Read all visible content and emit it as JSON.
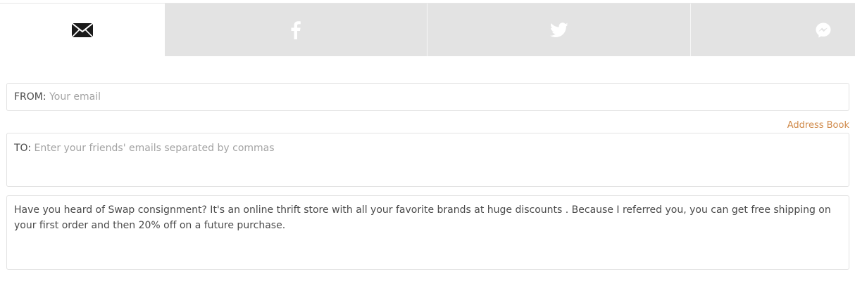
{
  "tabs": [
    {
      "name": "email",
      "icon": "envelope-icon",
      "active": true
    },
    {
      "name": "facebook",
      "icon": "facebook-icon",
      "active": false
    },
    {
      "name": "twitter",
      "icon": "twitter-icon",
      "active": false
    },
    {
      "name": "messenger",
      "icon": "messenger-icon",
      "active": false
    }
  ],
  "from": {
    "label": "FROM:",
    "placeholder": "Your email"
  },
  "address_book": "Address Book",
  "to": {
    "label": "TO:",
    "placeholder": "Enter your friends' emails separated by commas"
  },
  "message": {
    "text": "Have you heard of Swap consignment? It's an online thrift store with all your favorite brands at huge discounts . Because I referred you, you can get free shipping on your first order and then 20% off on a future purchase."
  },
  "colors": {
    "tab_inactive": "#e3e3e3",
    "tab_active": "#ffffff",
    "link_accent": "#d08a4a",
    "border": "#e2e2e2"
  }
}
